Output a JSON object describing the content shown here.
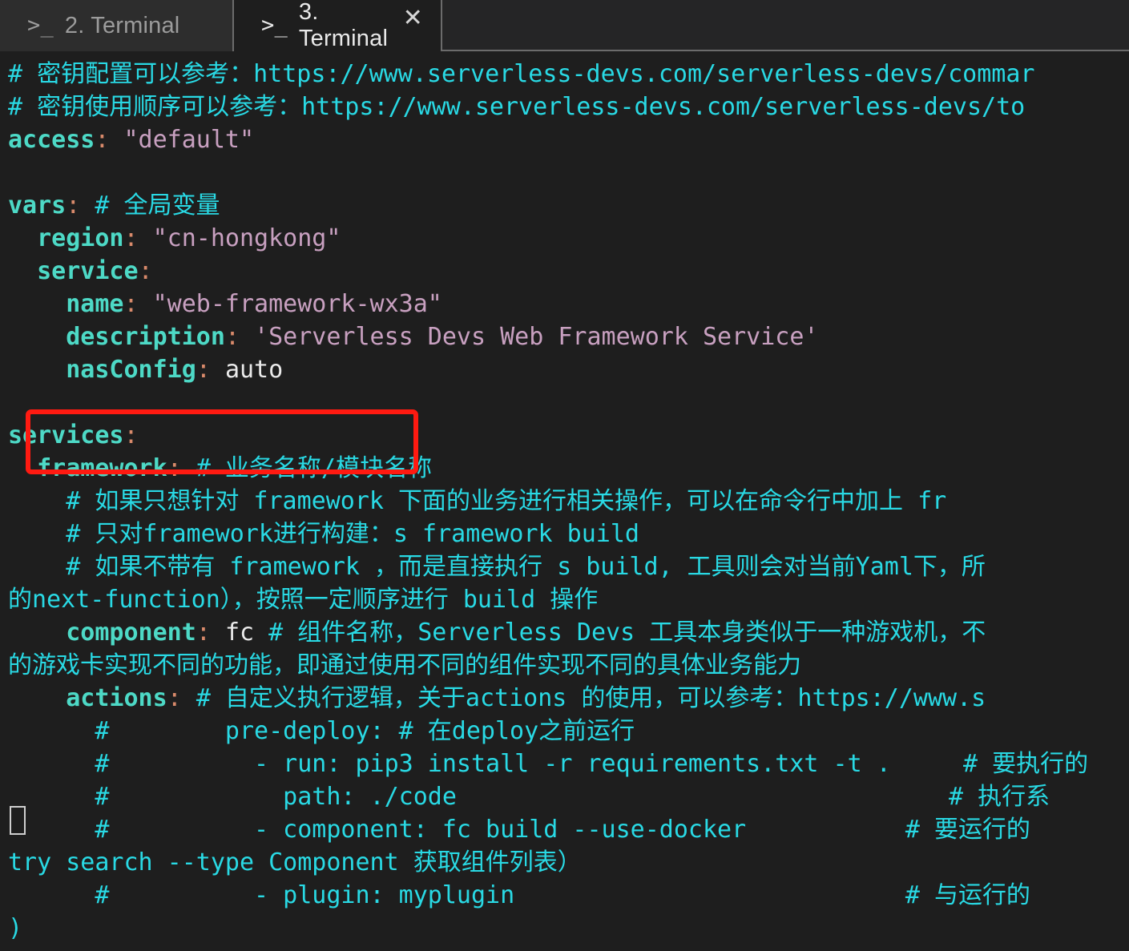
{
  "window": {
    "kind": "vscode-integrated-terminal",
    "background": "#1e1e1e"
  },
  "tabbar": {
    "tabs": [
      {
        "prompt_icon": ">_",
        "label": "2. Terminal",
        "active": false,
        "closable": false
      },
      {
        "prompt_icon": ">_",
        "label": "3. Terminal",
        "active": true,
        "closable": true,
        "close_icon": "✕"
      }
    ]
  },
  "colors": {
    "comment": "#29d9e4",
    "key": "#4dd9c6",
    "colon": "#d98a6b",
    "string": "#c8a0c0",
    "plain": "#eaeaea",
    "annotation_box": "#ff1a11",
    "tab_active_bg": "#1e1e1e",
    "tab_inactive_bg": "#2d2d2d",
    "tabbar_bg": "#252526"
  },
  "annotation": {
    "type": "red-rectangle-highlight",
    "target_line": "nasConfig: auto"
  },
  "terminal": {
    "cursor": {
      "shape": "hollow-block",
      "line_index": 21
    },
    "lines": [
      [
        {
          "t": "# 密钥配置可以参考：https://www.serverless-devs.com/serverless-devs/commar",
          "c": "cm"
        }
      ],
      [
        {
          "t": "# 密钥使用顺序可以参考：https://www.serverless-devs.com/serverless-devs/to",
          "c": "cm"
        }
      ],
      [
        {
          "t": "access",
          "c": "key"
        },
        {
          "t": ":",
          "c": "col"
        },
        {
          "t": " ",
          "c": "pln"
        },
        {
          "t": "\"default\"",
          "c": "str"
        }
      ],
      [],
      [
        {
          "t": "vars",
          "c": "key"
        },
        {
          "t": ":",
          "c": "col"
        },
        {
          "t": " ",
          "c": "pln"
        },
        {
          "t": "# 全局变量",
          "c": "cm"
        }
      ],
      [
        {
          "t": "  ",
          "c": "pln"
        },
        {
          "t": "region",
          "c": "key"
        },
        {
          "t": ":",
          "c": "col"
        },
        {
          "t": " ",
          "c": "pln"
        },
        {
          "t": "\"cn-hongkong\"",
          "c": "str"
        }
      ],
      [
        {
          "t": "  ",
          "c": "pln"
        },
        {
          "t": "service",
          "c": "key"
        },
        {
          "t": ":",
          "c": "col"
        }
      ],
      [
        {
          "t": "    ",
          "c": "pln"
        },
        {
          "t": "name",
          "c": "key"
        },
        {
          "t": ":",
          "c": "col"
        },
        {
          "t": " ",
          "c": "pln"
        },
        {
          "t": "\"web-framework-wx3a\"",
          "c": "str"
        }
      ],
      [
        {
          "t": "    ",
          "c": "pln"
        },
        {
          "t": "description",
          "c": "key"
        },
        {
          "t": ":",
          "c": "col"
        },
        {
          "t": " ",
          "c": "pln"
        },
        {
          "t": "'Serverless Devs Web Framework Service'",
          "c": "str"
        }
      ],
      [
        {
          "t": "    ",
          "c": "pln"
        },
        {
          "t": "nasConfig",
          "c": "key"
        },
        {
          "t": ":",
          "c": "col"
        },
        {
          "t": " ",
          "c": "pln"
        },
        {
          "t": "auto",
          "c": "pln"
        }
      ],
      [],
      [
        {
          "t": "services",
          "c": "key"
        },
        {
          "t": ":",
          "c": "col"
        }
      ],
      [
        {
          "t": "  ",
          "c": "pln"
        },
        {
          "t": "framework",
          "c": "key"
        },
        {
          "t": ":",
          "c": "col"
        },
        {
          "t": " ",
          "c": "pln"
        },
        {
          "t": "# 业务名称/模块名称",
          "c": "cm"
        }
      ],
      [
        {
          "t": "    # 如果只想针对 framework 下面的业务进行相关操作，可以在命令行中加上 fr",
          "c": "cm"
        }
      ],
      [
        {
          "t": "    # 只对framework进行构建：s framework build",
          "c": "cm"
        }
      ],
      [
        {
          "t": "    # 如果不带有 framework ，而是直接执行 s build, 工具则会对当前Yaml下，所",
          "c": "cm"
        }
      ],
      [
        {
          "t": "的next-function），按照一定顺序进行 build 操作",
          "c": "cm"
        }
      ],
      [
        {
          "t": "    ",
          "c": "pln"
        },
        {
          "t": "component",
          "c": "key"
        },
        {
          "t": ":",
          "c": "col"
        },
        {
          "t": " ",
          "c": "pln"
        },
        {
          "t": "fc",
          "c": "pln"
        },
        {
          "t": " ",
          "c": "pln"
        },
        {
          "t": "# 组件名称，Serverless Devs 工具本身类似于一种游戏机，不",
          "c": "cm"
        }
      ],
      [
        {
          "t": "的游戏卡实现不同的功能，即通过使用不同的组件实现不同的具体业务能力",
          "c": "cm"
        }
      ],
      [
        {
          "t": "    ",
          "c": "pln"
        },
        {
          "t": "actions",
          "c": "key"
        },
        {
          "t": ":",
          "c": "col"
        },
        {
          "t": " ",
          "c": "pln"
        },
        {
          "t": "# 自定义执行逻辑，关于actions 的使用，可以参考：https://www.s",
          "c": "cm"
        }
      ],
      [
        {
          "t": "      #        pre-deploy: # 在deploy之前运行",
          "c": "cm"
        }
      ],
      [
        {
          "t": "      #          - run: pip3 install -r requirements.txt -t .     # 要执行的",
          "c": "cm"
        }
      ],
      [
        {
          "t": "      #            path: ./code                                  # 执行系",
          "c": "cm"
        }
      ],
      [
        {
          "t": "      #          - component: fc build --use-docker           # 要运行的",
          "c": "cm"
        }
      ],
      [
        {
          "t": "try search --type Component 获取组件列表）",
          "c": "cm"
        }
      ],
      [
        {
          "t": "      #          - plugin: myplugin                           # 与运行的",
          "c": "cm"
        }
      ],
      [
        {
          "t": ")",
          "c": "cm"
        }
      ]
    ]
  }
}
